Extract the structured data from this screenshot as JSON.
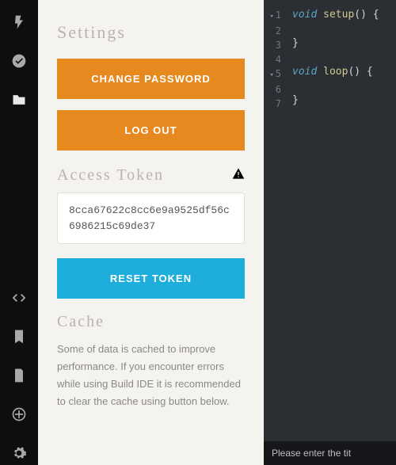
{
  "sidebar_icons": [
    "flash",
    "check-circle",
    "folder",
    "code",
    "bookmark",
    "document",
    "target",
    "gear"
  ],
  "settings": {
    "heading": "Settings",
    "change_password": "CHANGE PASSWORD",
    "log_out": "LOG OUT",
    "access_token_heading": "Access Token",
    "access_token_value": "8cca67622c8cc6e9a9525df56c6986215c69de37",
    "reset_token": "RESET TOKEN",
    "cache_heading": "Cache",
    "cache_text": "Some of data is cached to improve performance. If you encounter errors while using Build IDE it is recommended to clear the cache using button below."
  },
  "editor": {
    "lines": [
      {
        "n": 1,
        "fold": true,
        "html": "<span class='kw'>void</span> <span class='fn'>setup</span><span class='pn'>()</span> {"
      },
      {
        "n": 2,
        "html": ""
      },
      {
        "n": 3,
        "html": "}"
      },
      {
        "n": 4,
        "html": ""
      },
      {
        "n": 5,
        "fold": true,
        "html": "<span class='kw'>void</span> <span class='fn'>loop</span><span class='pn'>()</span> {"
      },
      {
        "n": 6,
        "html": ""
      },
      {
        "n": 7,
        "html": "}"
      }
    ],
    "status_text": "Please enter the tit"
  }
}
